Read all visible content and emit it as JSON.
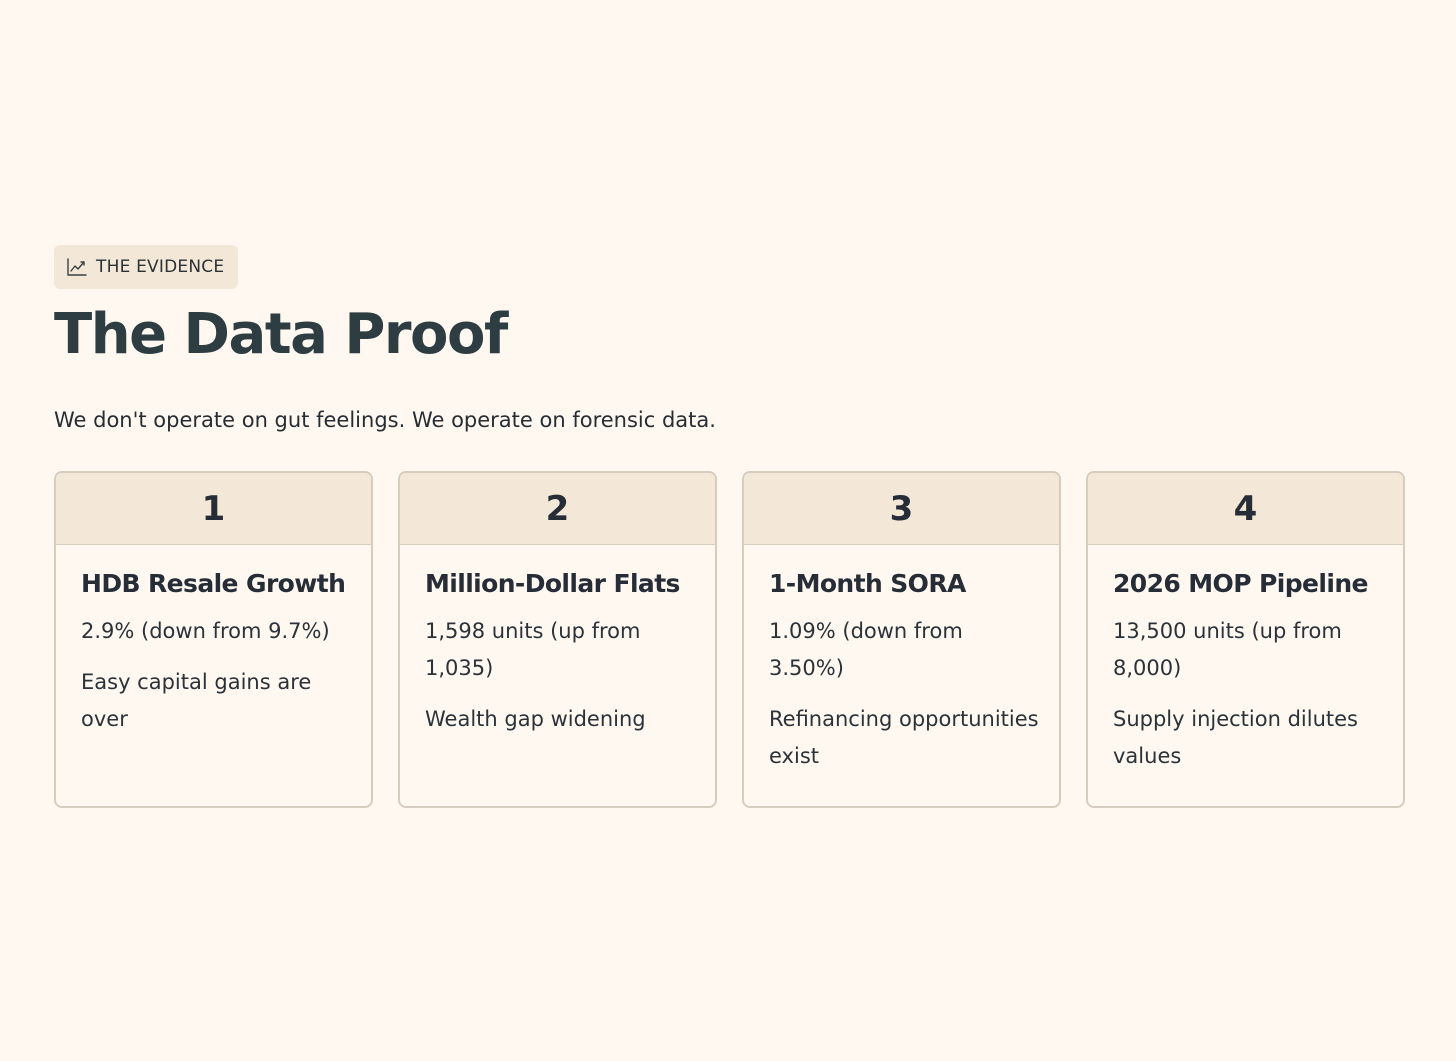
{
  "section": {
    "tag": {
      "icon": "trend-chart-icon",
      "label": "THE EVIDENCE"
    },
    "title": "The Data Proof",
    "subtitle": "We don't operate on gut feelings. We operate on forensic data."
  },
  "cards": [
    {
      "number": "1",
      "title": "HDB Resale Growth",
      "stat": "2.9% (down from 9.7%)",
      "note": "Easy capital gains are over"
    },
    {
      "number": "2",
      "title": "Million-Dollar Flats",
      "stat": "1,598 units (up from 1,035)",
      "note": "Wealth gap widening"
    },
    {
      "number": "3",
      "title": "1-Month SORA",
      "stat": "1.09% (down from 3.50%)",
      "note": "Refinancing opportunities exist"
    },
    {
      "number": "4",
      "title": "2026 MOP Pipeline",
      "stat": "13,500 units (up from 8,000)",
      "note": "Supply injection dilutes values"
    }
  ],
  "colors": {
    "background": "#fef8f1",
    "accent_fill": "#f3e8d8",
    "border": "#d6cdbf",
    "heading": "#2d3d42"
  }
}
